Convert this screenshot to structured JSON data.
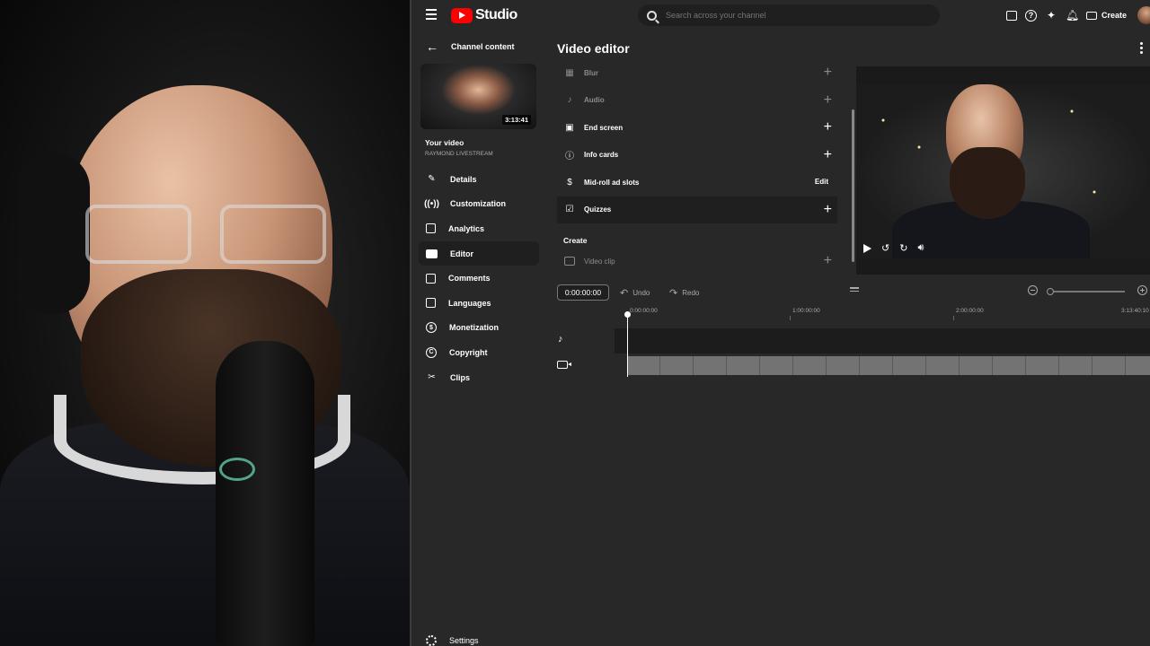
{
  "app": {
    "brand": "Studio"
  },
  "search": {
    "placeholder": "Search across your channel"
  },
  "topbar": {
    "create_label": "Create"
  },
  "sidebar": {
    "back_label": "Channel content",
    "thumbnail_duration": "3:13:41",
    "your_video_label": "Your video",
    "channel_name": "RAYMOND LIVESTREAM",
    "items": [
      {
        "label": "Details",
        "icon": "pencil-icon"
      },
      {
        "label": "Customization",
        "icon": "broadcast-icon"
      },
      {
        "label": "Analytics",
        "icon": "analytics-icon"
      },
      {
        "label": "Editor",
        "icon": "editor-icon",
        "active": true
      },
      {
        "label": "Comments",
        "icon": "comments-icon"
      },
      {
        "label": "Languages",
        "icon": "subtitles-icon"
      },
      {
        "label": "Monetization",
        "icon": "dollar-icon"
      },
      {
        "label": "Copyright",
        "icon": "copyright-icon"
      },
      {
        "label": "Clips",
        "icon": "scissors-icon"
      }
    ],
    "settings_label": "Settings"
  },
  "editor": {
    "title": "Video editor",
    "tools": [
      {
        "label": "Blur",
        "action": "+"
      },
      {
        "label": "Audio",
        "action": "+"
      },
      {
        "label": "End screen",
        "action": "+"
      },
      {
        "label": "Info cards",
        "action": "+"
      },
      {
        "label": "Mid-roll ad slots",
        "action": "Edit"
      },
      {
        "label": "Quizzes",
        "action": "+"
      }
    ],
    "create_heading": "Create",
    "video_clip_label": "Video clip"
  },
  "timeline": {
    "timecode": "0:00:00:00",
    "undo_label": "Undo",
    "redo_label": "Redo",
    "ruler_labels": [
      "0:00:00:00",
      "1:00:00:00",
      "2:00:00:00",
      "3:13:40:10"
    ],
    "zoom_level": 0
  },
  "colors": {
    "accent_red": "#ff0000",
    "background": "#282828",
    "panel": "#1f1f1f"
  }
}
